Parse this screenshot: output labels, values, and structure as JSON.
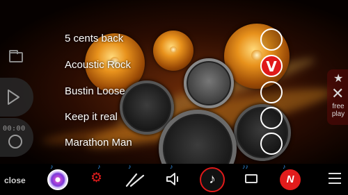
{
  "left_panel": {
    "timer": "00:00"
  },
  "free_play": {
    "label_line1": "free",
    "label_line2": "play"
  },
  "songs": [
    {
      "title": "5 cents back",
      "selected": false
    },
    {
      "title": "Acoustic Rock",
      "selected": true
    },
    {
      "title": "Bustin Loose",
      "selected": false
    },
    {
      "title": "Keep it real",
      "selected": false
    },
    {
      "title": "Marathon Man",
      "selected": false
    }
  ],
  "check_mark": "V",
  "toolbar": {
    "close_label": "close",
    "items": [
      {
        "icon": "cd-music-icon"
      },
      {
        "icon": "gear-icon"
      },
      {
        "icon": "drumsticks-icon"
      },
      {
        "icon": "speaker-icon"
      },
      {
        "icon": "music-note-icon"
      },
      {
        "icon": "screen-icon"
      },
      {
        "icon": "n-logo-icon"
      },
      {
        "icon": "menu-icon"
      }
    ]
  },
  "colors": {
    "accent_red": "#e01a1a",
    "note_blue": "#3aa0ff"
  }
}
